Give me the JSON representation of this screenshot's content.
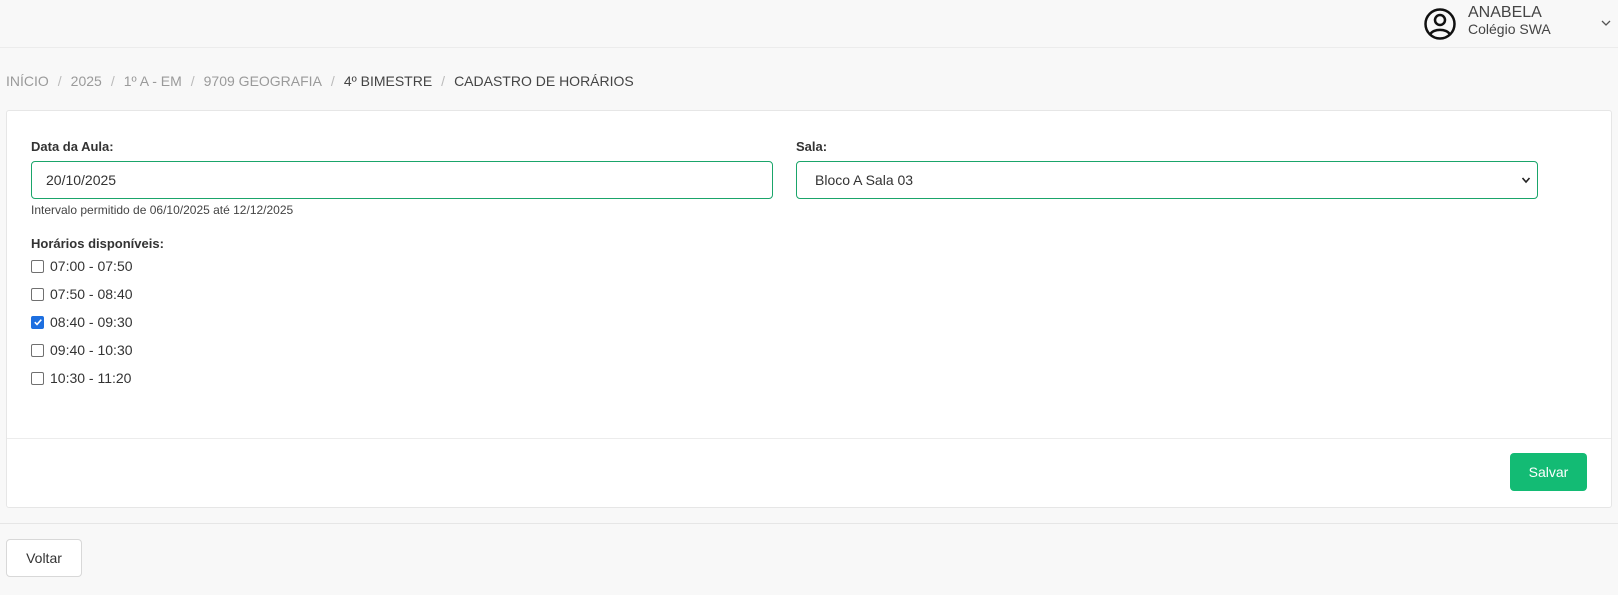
{
  "user": {
    "name": "ANABELA",
    "school": "Colégio SWA",
    "avatar_icon": "user-circle-icon",
    "menu_icon": "chevron-down-icon"
  },
  "breadcrumb": [
    "INÍCIO",
    "2025",
    "1º A - EM",
    "9709 GEOGRAFIA",
    "4º BIMESTRE",
    "CADASTRO DE HORÁRIOS"
  ],
  "form": {
    "date_label": "Data da Aula:",
    "date_value": "20/10/2025",
    "date_hint": "Intervalo permitido de 06/10/2025 até 12/12/2025",
    "room_label": "Sala:",
    "room_value": "Bloco A Sala 03",
    "slots_label": "Horários disponíveis:",
    "slots": [
      {
        "label": "07:00 - 07:50",
        "checked": false
      },
      {
        "label": "07:50 - 08:40",
        "checked": false
      },
      {
        "label": "08:40 - 09:30",
        "checked": true
      },
      {
        "label": "09:40 - 10:30",
        "checked": false
      },
      {
        "label": "10:30 - 11:20",
        "checked": false
      }
    ],
    "save_label": "Salvar"
  },
  "back_label": "Voltar",
  "colors": {
    "accent": "#13bb74",
    "field_border": "#1aa56a",
    "checkbox_checked": "#1d6fe0"
  }
}
